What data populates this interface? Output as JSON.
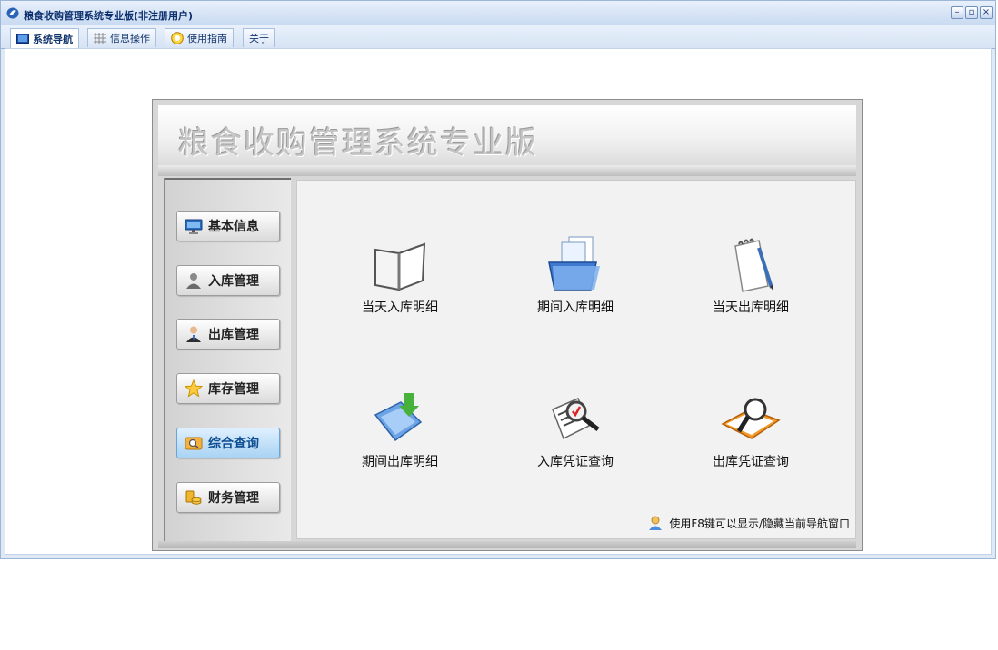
{
  "window": {
    "title": "粮食收购管理系统专业版(非注册用户)",
    "controls": {
      "minimize": "–",
      "restore": "▫",
      "close": "×"
    }
  },
  "tabs": [
    {
      "label": "系统导航",
      "icon": "monitor-icon",
      "active": true
    },
    {
      "label": "信息操作",
      "icon": "grid-icon",
      "active": false
    },
    {
      "label": "使用指南",
      "icon": "help-icon",
      "active": false
    },
    {
      "label": "关于",
      "icon": "",
      "active": false
    }
  ],
  "banner": {
    "title": "粮食收购管理系统专业版"
  },
  "sidebar": {
    "items": [
      {
        "label": "基本信息",
        "icon": "monitor-icon",
        "selected": false
      },
      {
        "label": "入库管理",
        "icon": "user-icon",
        "selected": false
      },
      {
        "label": "出库管理",
        "icon": "user-tie-icon",
        "selected": false
      },
      {
        "label": "库存管理",
        "icon": "star-icon",
        "selected": false
      },
      {
        "label": "综合查询",
        "icon": "search-folder-icon",
        "selected": true
      },
      {
        "label": "财务管理",
        "icon": "coins-icon",
        "selected": false
      }
    ]
  },
  "main": {
    "items": [
      {
        "label": "当天入库明细",
        "icon": "notebook-icon"
      },
      {
        "label": "期间入库明细",
        "icon": "folder-docs-icon"
      },
      {
        "label": "当天出库明细",
        "icon": "notepad-pen-icon"
      },
      {
        "label": "期间出库明细",
        "icon": "download-docs-icon"
      },
      {
        "label": "入库凭证查询",
        "icon": "document-magnifier-icon"
      },
      {
        "label": "出库凭证查询",
        "icon": "book-magnifier-icon"
      }
    ],
    "hint": "使用F8键可以显示/隐藏当前导航窗口"
  },
  "colors": {
    "accent": "#0c2f6e",
    "selected_nav": "#a9d3f3",
    "frame": "#dfe9f6"
  }
}
